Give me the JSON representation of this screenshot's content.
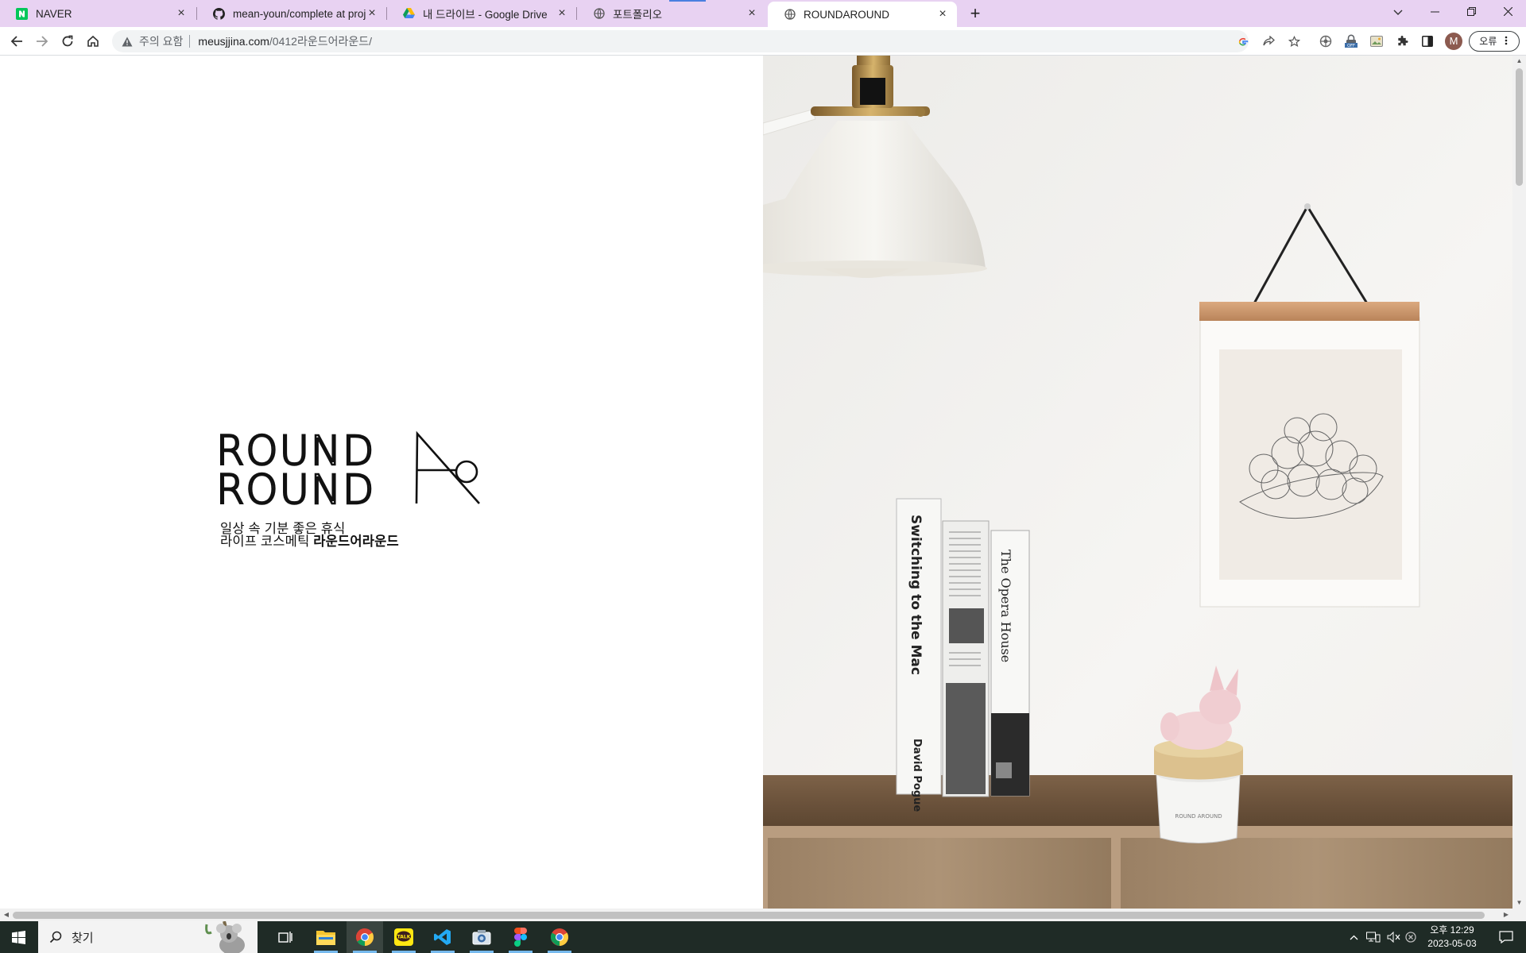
{
  "browser": {
    "tabs": [
      {
        "title": "NAVER",
        "icon": "naver-icon",
        "active": false
      },
      {
        "title": "mean-youn/complete at project",
        "icon": "github-icon",
        "active": false
      },
      {
        "title": "내 드라이브 - Google Drive",
        "icon": "google-drive-icon",
        "active": false
      },
      {
        "title": "포트폴리오",
        "icon": "globe-icon",
        "active": false
      },
      {
        "title": "ROUNDAROUND",
        "icon": "globe-icon",
        "active": true
      }
    ],
    "address": {
      "security_label": "주의 요함",
      "host": "meusjjina.com",
      "path": "/0412라운드어라운드/"
    },
    "profile_initial": "M",
    "profile_button": "오류"
  },
  "page": {
    "logo_line1": "ROUND",
    "logo_line2": "ROUND",
    "tagline_line1": "일상 속 기분 좋은 휴식",
    "tagline_line2_prefix": "라이프 코스메틱 ",
    "tagline_line2_brand": "라운드어라운드",
    "photo": {
      "book1_title": "Switching to the Mac",
      "book1_author": "David Pogue",
      "book3_title": "The Opera House",
      "jar_label": "ROUND AROUND"
    }
  },
  "taskbar": {
    "search_placeholder": "찾기",
    "time": "오후 12:29",
    "date": "2023-05-03"
  },
  "colors": {
    "tabstrip": "#e8d2f2",
    "taskbar": "#1f2b26",
    "naver_green": "#03c75a"
  }
}
